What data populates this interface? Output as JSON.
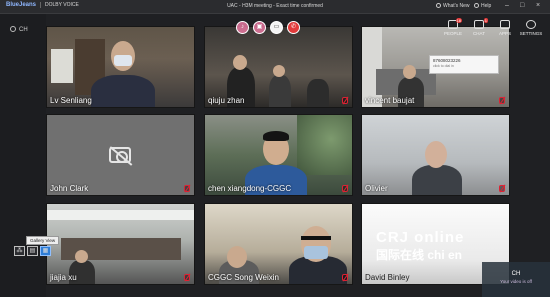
{
  "topbar": {
    "brand": "BlueJeans",
    "brand_partner": "DOLBY VOICE",
    "title": "UAC - H3M meeting - Exact time confirmed",
    "whats_new": "What's New",
    "help": "Help"
  },
  "status": {
    "label": "CH"
  },
  "controls": [
    "mute",
    "video",
    "share",
    "end-call"
  ],
  "toolbar": [
    {
      "label": "PEOPLE",
      "badge": "18"
    },
    {
      "label": "CHAT",
      "badge": "1"
    },
    {
      "label": "APPS"
    },
    {
      "label": "SETTINGS"
    }
  ],
  "popup": {
    "line1": "87608023226",
    "line2": "click to dial in"
  },
  "tiles": [
    {
      "name": "Lv Senliang"
    },
    {
      "name": "qiuju zhan"
    },
    {
      "name": "vincent baujat"
    },
    {
      "name": "John Clark",
      "camera": "off"
    },
    {
      "name": "chen xiangdong-CGGC"
    },
    {
      "name": "Olivier"
    },
    {
      "name": "jiajia xu"
    },
    {
      "name": "CGGC Song Weixin"
    },
    {
      "name": "David Binley"
    }
  ],
  "gallery_tooltip": "Gallery View",
  "watermark": {
    "line1": "CRJ online",
    "line2": "国际在线 chi  en"
  },
  "notification": {
    "title": "CH",
    "text": "Your video is off"
  }
}
